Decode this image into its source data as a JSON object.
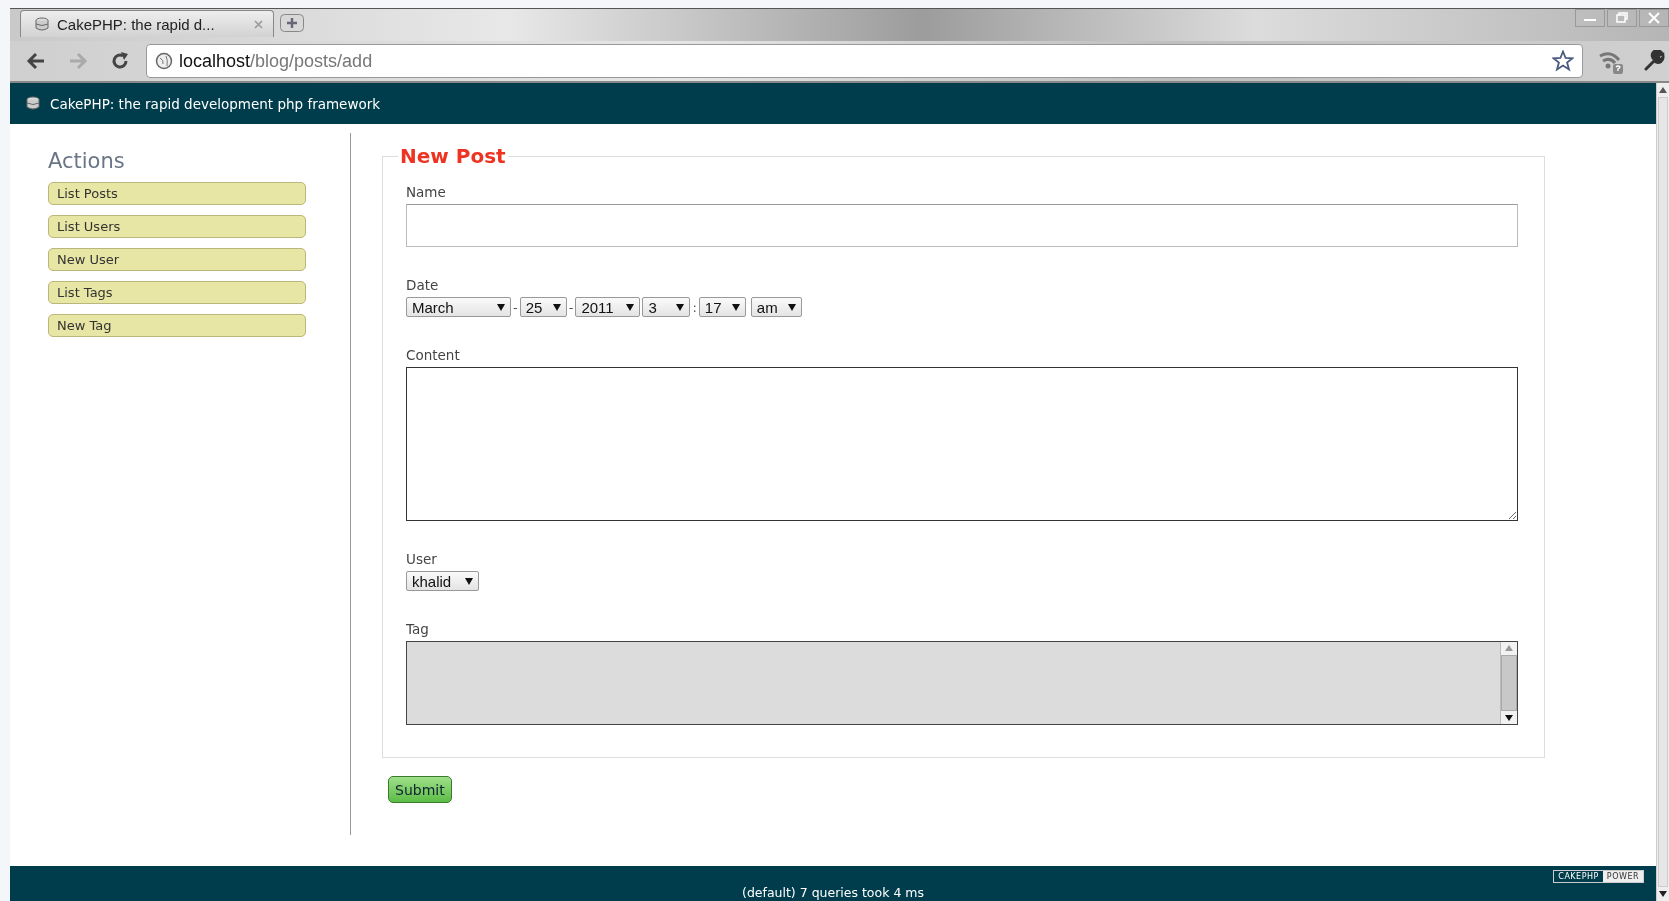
{
  "browser": {
    "tab_title": "CakePHP: the rapid d...",
    "url_host": "localhost",
    "url_path": "/blog/posts/add"
  },
  "header": {
    "title": "CakePHP: the rapid development php framework"
  },
  "sidebar": {
    "heading": "Actions",
    "items": [
      "List Posts",
      "List Users",
      "New User",
      "List Tags",
      "New Tag"
    ]
  },
  "form": {
    "legend": "New Post",
    "fields": [
      {
        "kind": "text",
        "label": "Name"
      },
      {
        "kind": "datetime",
        "label": "Date",
        "parts": [
          {
            "value": "March",
            "separator": "-"
          },
          {
            "value": "25",
            "separator": "-"
          },
          {
            "value": "2011"
          },
          {
            "value": "3",
            "separator": ":"
          },
          {
            "value": "17"
          },
          {
            "value": "am"
          }
        ]
      },
      {
        "kind": "textarea",
        "label": "Content"
      },
      {
        "kind": "select",
        "label": "User",
        "value": "khalid"
      },
      {
        "kind": "multiselect",
        "label": "Tag"
      }
    ]
  },
  "submit": "Submit",
  "footer": {
    "text": "(default) 7 queries took 4 ms",
    "badge": [
      "CAKEPHP",
      "POWER"
    ]
  }
}
